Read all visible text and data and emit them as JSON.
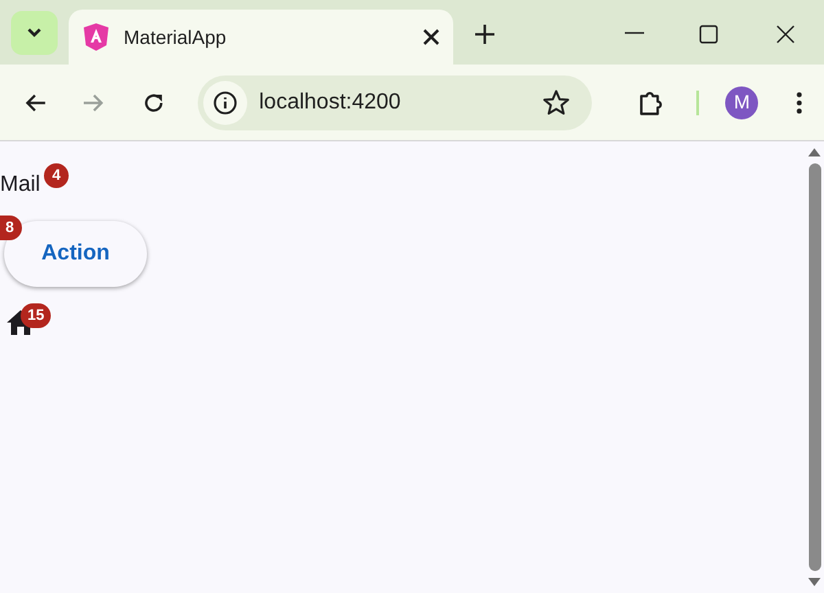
{
  "browser": {
    "tab": {
      "title": "MaterialApp",
      "selected": true
    },
    "address": "localhost:4200",
    "profile_initial": "M"
  },
  "page": {
    "mail": {
      "label": "Mail",
      "badge": "4"
    },
    "action_button": {
      "label": "Action",
      "badge": "8"
    },
    "home": {
      "badge": "15"
    }
  }
}
